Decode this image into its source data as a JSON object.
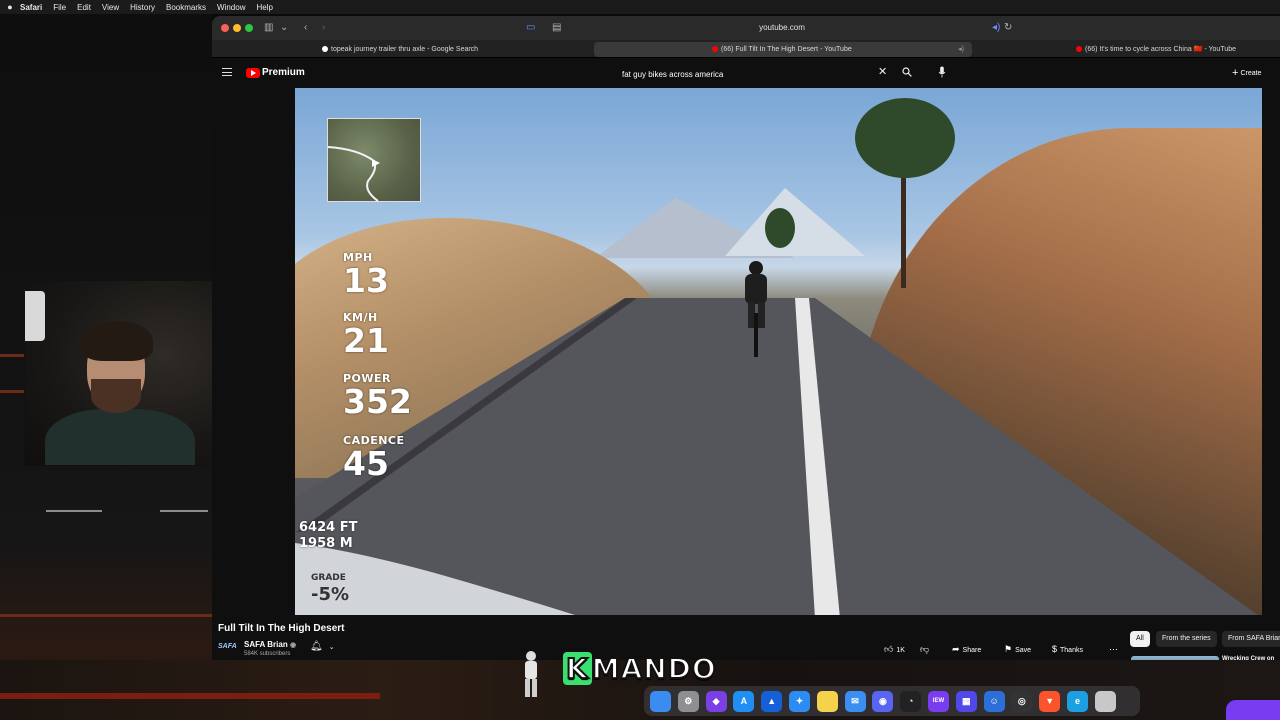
{
  "menubar": {
    "items": [
      "Safari",
      "File",
      "Edit",
      "View",
      "History",
      "Bookmarks",
      "Window",
      "Help"
    ]
  },
  "browser": {
    "url": "youtube.com",
    "tabs": [
      {
        "label": "topeak journey trailer thru axle - Google Search",
        "favicon_color": "#ffffff"
      },
      {
        "label": "(66) Full Tilt In The High Desert - YouTube",
        "favicon_color": "#ff0000"
      },
      {
        "label": "(66) It's time to cycle across China 🇨🇳 - YouTube",
        "favicon_color": "#ff0000"
      }
    ]
  },
  "youtube": {
    "logo_label": "Premium",
    "search_value": "fat guy bikes across america",
    "create_label": "Create",
    "video_overlay": {
      "mph_label": "MPH",
      "mph_value": "13",
      "kmh_label": "KM/H",
      "kmh_value": "21",
      "power_label": "POWER",
      "power_value": "352",
      "cadence_label": "CADENCE",
      "cadence_value": "45",
      "elev_ft": "6424 FT",
      "elev_m": "1958 M",
      "grade_label": "GRADE",
      "grade_value": "-5%"
    },
    "video_title": "Full Tilt In The High Desert",
    "channel": {
      "avatar_text": "SAFA",
      "name": "SAFA Brian",
      "subscribers": "584K subscribers"
    },
    "actions": {
      "like_count": "1K",
      "share_label": "Share",
      "save_label": "Save",
      "thanks_label": "Thanks"
    },
    "chips": [
      "All",
      "From the series",
      "From SAFA Brian"
    ],
    "related_title": "Wrecking Crew on"
  },
  "overlay": {
    "brand_k": "K",
    "brand_rest": "MANDO"
  },
  "dock": {
    "icons": [
      {
        "name": "finder-icon",
        "color": "#3b8cf0",
        "glyph": ""
      },
      {
        "name": "system-settings-icon",
        "color": "#8e8e93",
        "glyph": "⚙"
      },
      {
        "name": "shield-app-icon",
        "color": "#7b3fe4",
        "glyph": "◆"
      },
      {
        "name": "app-store-icon",
        "color": "#1f8ff5",
        "glyph": "A"
      },
      {
        "name": "safari-blue-icon",
        "color": "#1560d6",
        "glyph": "▲"
      },
      {
        "name": "safari-compass-icon",
        "color": "#2c8cf4",
        "glyph": "✦"
      },
      {
        "name": "notes-icon",
        "color": "#f5d24b",
        "glyph": ""
      },
      {
        "name": "mail-icon",
        "color": "#3a8ff0",
        "glyph": "✉"
      },
      {
        "name": "discord-icon",
        "color": "#5865f2",
        "glyph": "◉"
      },
      {
        "name": "activity-icon",
        "color": "#222222",
        "glyph": "◔"
      },
      {
        "name": "iew-app-icon",
        "color": "#7a3cf0",
        "glyph": "IEW"
      },
      {
        "name": "launchpad-icon",
        "color": "#5048e8",
        "glyph": "▦"
      },
      {
        "name": "finder-2-icon",
        "color": "#2d6fd8",
        "glyph": "☺"
      },
      {
        "name": "obs-icon",
        "color": "#333333",
        "glyph": "◎"
      },
      {
        "name": "brave-icon",
        "color": "#fb542b",
        "glyph": "▼"
      },
      {
        "name": "edge-icon",
        "color": "#1ba1e2",
        "glyph": "e"
      },
      {
        "name": "trash-icon",
        "color": "#c8c8c8",
        "glyph": ""
      }
    ]
  }
}
